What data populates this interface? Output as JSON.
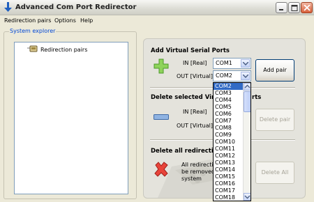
{
  "window": {
    "title": "Advanced Com Port Redirector"
  },
  "menu": [
    "Redirection pairs",
    "Options",
    "Help"
  ],
  "explorer": {
    "title": "System explorer",
    "root_label": "Redirection pairs"
  },
  "add_section": {
    "title": "Add Virtual Serial Ports",
    "in_label": "IN [Real]",
    "out_label": "OUT [Virtual]",
    "in_value": "COM1",
    "out_value": "COM2",
    "button": "Add pair"
  },
  "delete_section": {
    "title_visible_1": "Delete selected Virtu",
    "title_visible_2": "rts",
    "in_label": "IN [Real]",
    "out_label": "OUT [Virtual]",
    "button": "Delete pair"
  },
  "delete_all_section": {
    "title_visible": "Delete all redirection",
    "desc_line1": "All redirection",
    "desc_line2": "be removed",
    "desc_line3": "system",
    "button": "Delete All"
  },
  "dropdown": {
    "selected": "COM2",
    "options": [
      "COM2",
      "COM3",
      "COM4",
      "COM5",
      "COM6",
      "COM7",
      "COM8",
      "COM9",
      "COM10",
      "COM11",
      "COM12",
      "COM13",
      "COM14",
      "COM15",
      "COM16",
      "COM17",
      "COM18"
    ]
  }
}
